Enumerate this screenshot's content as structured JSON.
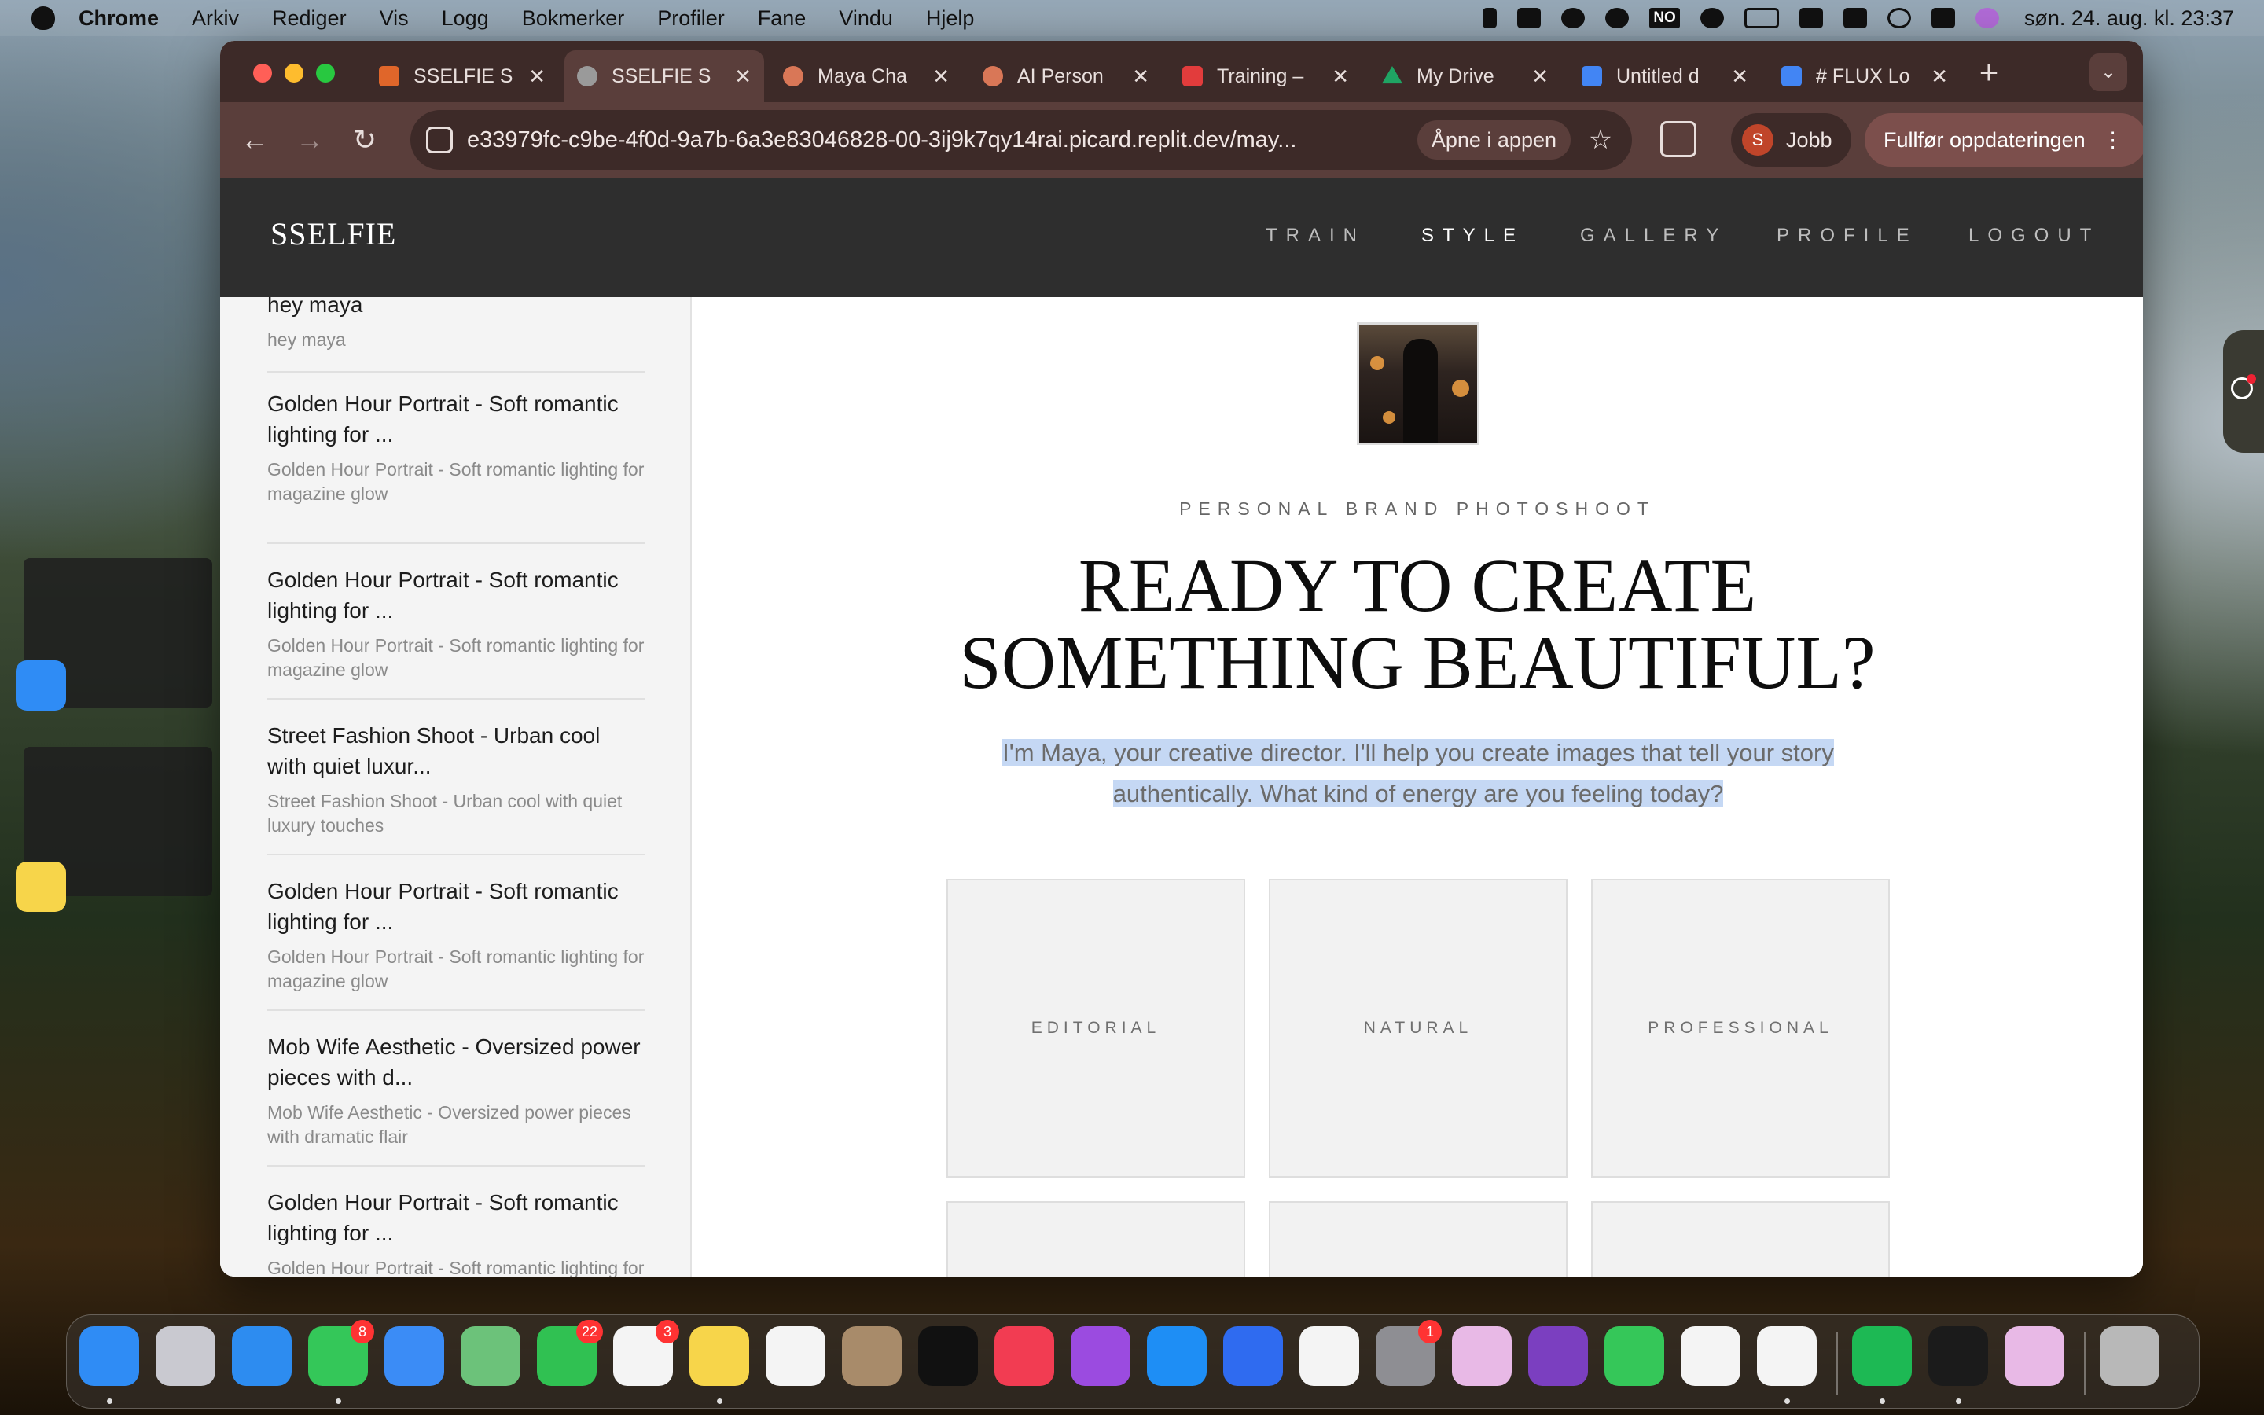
{
  "menubar": {
    "app": "Chrome",
    "items": [
      "Arkiv",
      "Rediger",
      "Vis",
      "Logg",
      "Bokmerker",
      "Profiler",
      "Fane",
      "Vindu",
      "Hjelp"
    ],
    "status_text": "NO",
    "clock": "søn. 24. aug. kl. 23:37"
  },
  "browser": {
    "tabs": [
      {
        "title": "SSELFIE S",
        "active": false,
        "favicon_color": "#e0662a"
      },
      {
        "title": "SSELFIE S",
        "active": true,
        "favicon_color": "#9a9a9a"
      },
      {
        "title": "Maya Cha",
        "active": false,
        "favicon_color": "#d97757"
      },
      {
        "title": "AI Person",
        "active": false,
        "favicon_color": "#d97757"
      },
      {
        "title": "Training –",
        "active": false,
        "favicon_color": "#e23c3c"
      },
      {
        "title": "My Drive",
        "active": false,
        "favicon_color": "#1fa463"
      },
      {
        "title": "Untitled d",
        "active": false,
        "favicon_color": "#4285f4"
      },
      {
        "title": "# FLUX Lo",
        "active": false,
        "favicon_color": "#4285f4"
      }
    ],
    "url": "e33979fc-c9be-4f0d-9a7b-6a3e83046828-00-3ij9k7qy14rai.picard.replit.dev/may...",
    "open_in_app": "Åpne i appen",
    "profile": {
      "initial": "S",
      "name": "Jobb"
    },
    "update_button": "Fullfør oppdateringen"
  },
  "site": {
    "logo": "SSELFIE",
    "nav": [
      {
        "label": "TRAIN",
        "active": false
      },
      {
        "label": "STYLE",
        "active": true
      },
      {
        "label": "GALLERY",
        "active": false
      },
      {
        "label": "PROFILE",
        "active": false
      },
      {
        "label": "LOGOUT",
        "active": false
      }
    ]
  },
  "sidebar": {
    "conversations": [
      {
        "title": "hey maya",
        "subtitle": "hey maya"
      },
      {
        "title": "Golden Hour Portrait - Soft romantic lighting for ...",
        "subtitle": "Golden Hour Portrait - Soft romantic lighting for magazine glow"
      },
      {
        "title": "Golden Hour Portrait - Soft romantic lighting for ...",
        "subtitle": "Golden Hour Portrait - Soft romantic lighting for magazine glow"
      },
      {
        "title": "Street Fashion Shoot - Urban cool with quiet luxur...",
        "subtitle": "Street Fashion Shoot - Urban cool with quiet luxury touches"
      },
      {
        "title": "Golden Hour Portrait - Soft romantic lighting for ...",
        "subtitle": "Golden Hour Portrait - Soft romantic lighting for magazine glow"
      },
      {
        "title": "Mob Wife Aesthetic - Oversized power pieces with d...",
        "subtitle": "Mob Wife Aesthetic - Oversized power pieces with dramatic flair"
      },
      {
        "title": "Golden Hour Portrait - Soft romantic lighting for ...",
        "subtitle": "Golden Hour Portrait - Soft romantic lighting for magazine glow"
      }
    ]
  },
  "main": {
    "eyebrow": "PERSONAL BRAND PHOTOSHOOT",
    "headline_line1": "READY TO CREATE",
    "headline_line2": "SOMETHING BEAUTIFUL?",
    "intro_line1": "I'm Maya, your creative director. I'll help you create images that tell your story",
    "intro_line2": "authentically. What kind of energy are you feeling today?",
    "style_options": [
      "EDITORIAL",
      "NATURAL",
      "PROFESSIONAL"
    ]
  },
  "dock": {
    "apps": [
      {
        "name": "finder-icon",
        "color": "#2f8cf5",
        "badge": ""
      },
      {
        "name": "launchpad-icon",
        "color": "#c9c9d0",
        "badge": ""
      },
      {
        "name": "safari-icon",
        "color": "#2d8cf0",
        "badge": ""
      },
      {
        "name": "messages-icon",
        "color": "#34c759",
        "badge": "8"
      },
      {
        "name": "mail-icon",
        "color": "#3b8cf6",
        "badge": ""
      },
      {
        "name": "maps-icon",
        "color": "#6cc27a",
        "badge": ""
      },
      {
        "name": "facetime-icon",
        "color": "#30c152",
        "badge": "22"
      },
      {
        "name": "reminders-icon",
        "color": "#f4f4f4",
        "badge": "3"
      },
      {
        "name": "notes-icon",
        "color": "#f7d54a",
        "badge": ""
      },
      {
        "name": "freeform-icon",
        "color": "#f4f4f4",
        "badge": ""
      },
      {
        "name": "contacts-icon",
        "color": "#a88b6a",
        "badge": ""
      },
      {
        "name": "apple-tv-icon",
        "color": "#111111",
        "badge": ""
      },
      {
        "name": "music-icon",
        "color": "#f23c52",
        "badge": ""
      },
      {
        "name": "podcasts-icon",
        "color": "#9b4be0",
        "badge": ""
      },
      {
        "name": "app-store-icon",
        "color": "#1e8ef5",
        "badge": ""
      },
      {
        "name": "roblox-icon",
        "color": "#2f6bf0",
        "badge": ""
      },
      {
        "name": "outlook-icon",
        "color": "#f4f4f4",
        "badge": ""
      },
      {
        "name": "system-settings-icon",
        "color": "#8e8e93",
        "badge": "1"
      },
      {
        "name": "keynote-icon",
        "color": "#e8b9e6",
        "badge": ""
      },
      {
        "name": "github-icon",
        "color": "#7b3fc0",
        "badge": ""
      },
      {
        "name": "numbers-icon",
        "color": "#35c759",
        "badge": ""
      },
      {
        "name": "perplexity-icon",
        "color": "#f4f4f4",
        "badge": ""
      },
      {
        "name": "chrome-icon",
        "color": "#f4f4f4",
        "badge": ""
      },
      {
        "name": "spotify-icon",
        "color": "#1db954",
        "badge": ""
      },
      {
        "name": "cube-app-icon",
        "color": "#1b1b1b",
        "badge": ""
      },
      {
        "name": "keynote-2-icon",
        "color": "#e8b9e6",
        "badge": ""
      },
      {
        "name": "trash-icon",
        "color": "#b8b8b8",
        "badge": ""
      }
    ]
  }
}
